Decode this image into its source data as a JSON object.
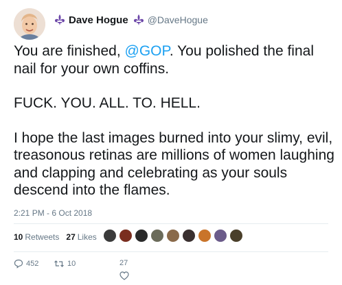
{
  "author": {
    "display_name": "Dave Hogue",
    "handle": "@DaveHogue",
    "emblem_icon": "fleur-de-lis-icon",
    "emblem_color": "#6b46a8"
  },
  "tweet": {
    "line1_before": "You are finished, ",
    "mention": "@GOP",
    "line1_after": ". You polished the final nail for your own coffins.",
    "paragraph2": "FUCK. YOU. ALL. TO. HELL.",
    "paragraph3": "I hope the last images burned into your slimy, evil, treasonous retinas are millions of women laughing and clapping and celebrating as your souls descend into the flames.",
    "timestamp": "2:21 PM - 6 Oct 2018"
  },
  "stats": {
    "retweets_count": "10",
    "retweets_label": "Retweets",
    "likes_count": "27",
    "likes_label": "Likes"
  },
  "likers": [
    "#3b3b3b",
    "#7a2e1f",
    "#2a2a2a",
    "#6b6b5a",
    "#8a6a4a",
    "#3a3030",
    "#c9742a",
    "#6b5b8a",
    "#4a3f2a"
  ],
  "actions": {
    "reply_count": "452",
    "retweet_count": "10",
    "like_count": "27"
  },
  "colors": {
    "mention": "#1da1f2",
    "secondary_text": "#657786"
  }
}
